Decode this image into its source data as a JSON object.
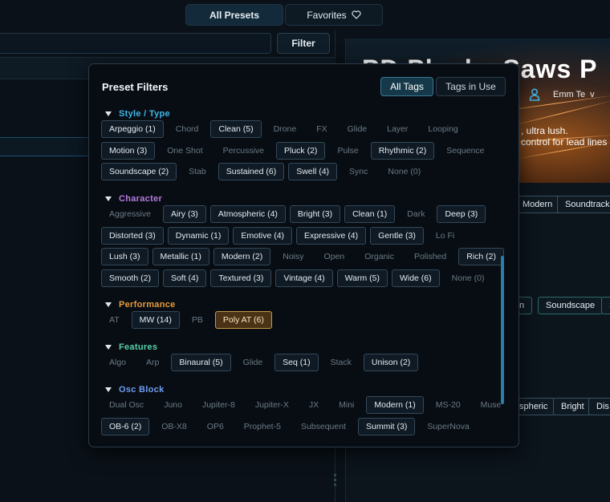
{
  "top_tabs": {
    "all_presets": "All Presets",
    "favorites": "Favorites"
  },
  "left": {
    "filter_button": "Filter"
  },
  "right": {
    "hero_title": "PD Plucks Saws P",
    "author": "Emm Te",
    "author_chevron": "v",
    "desc_line1": ", ultra lush.",
    "desc_line2": "control for lead lines",
    "tag_row1": [
      "Modern",
      "Soundtrack"
    ],
    "tag_row2": [
      "n",
      "Soundscape",
      "S"
    ],
    "tag_row3": [
      "spheric",
      "Bright",
      "Dis"
    ]
  },
  "popup": {
    "title": "Preset Filters",
    "seg_all": "All Tags",
    "seg_inuse": "Tags in Use",
    "sections": [
      {
        "name": "Style / Type",
        "color": "#3fb6e8",
        "rows": [
          [
            [
              "Arpeggio (1)",
              1
            ],
            [
              "Chord",
              0
            ],
            [
              "Clean (5)",
              1
            ],
            [
              "Drone",
              0
            ],
            [
              "FX",
              0
            ],
            [
              "Glide",
              0
            ],
            [
              "Layer",
              0
            ],
            [
              "Looping",
              0
            ]
          ],
          [
            [
              "Motion (3)",
              1
            ],
            [
              "One Shot",
              0
            ],
            [
              "Percussive",
              0
            ],
            [
              "Pluck (2)",
              1
            ],
            [
              "Pulse",
              0
            ],
            [
              "Rhythmic (2)",
              1
            ],
            [
              "Sequence",
              0
            ]
          ],
          [
            [
              "Soundscape (2)",
              1
            ],
            [
              "Stab",
              0
            ],
            [
              "Sustained (6)",
              1
            ],
            [
              "Swell (4)",
              1
            ],
            [
              "Sync",
              0
            ],
            [
              "None (0)",
              0
            ]
          ]
        ]
      },
      {
        "name": "Character",
        "color": "#b57ae0",
        "rows": [
          [
            [
              "Aggressive",
              0
            ],
            [
              "Airy (3)",
              1
            ],
            [
              "Atmospheric (4)",
              1
            ],
            [
              "Bright (3)",
              1
            ],
            [
              "Clean (1)",
              1
            ],
            [
              "Dark",
              0
            ],
            [
              "Deep (3)",
              1
            ]
          ],
          [
            [
              "Distorted (3)",
              1
            ],
            [
              "Dynamic (1)",
              1
            ],
            [
              "Emotive (4)",
              1
            ],
            [
              "Expressive (4)",
              1
            ],
            [
              "Gentle (3)",
              1
            ],
            [
              "Lo Fi",
              0
            ]
          ],
          [
            [
              "Lush (3)",
              1
            ],
            [
              "Metallic (1)",
              1
            ],
            [
              "Modern (2)",
              1
            ],
            [
              "Noisy",
              0
            ],
            [
              "Open",
              0
            ],
            [
              "Organic",
              0
            ],
            [
              "Polished",
              0
            ],
            [
              "Rich (2)",
              1
            ]
          ],
          [
            [
              "Smooth (2)",
              1
            ],
            [
              "Soft (4)",
              1
            ],
            [
              "Textured (3)",
              1
            ],
            [
              "Vintage (4)",
              1
            ],
            [
              "Warm (5)",
              1
            ],
            [
              "Wide (6)",
              1
            ],
            [
              "None (0)",
              0
            ]
          ]
        ]
      },
      {
        "name": "Performance",
        "color": "#e89a3c",
        "rows": [
          [
            [
              "AT",
              0
            ],
            [
              "MW (14)",
              1
            ],
            [
              "PB",
              0
            ],
            [
              "Poly AT (6)",
              2
            ]
          ]
        ]
      },
      {
        "name": "Features",
        "color": "#58d0a8",
        "rows": [
          [
            [
              "Algo",
              0
            ],
            [
              "Arp",
              0
            ],
            [
              "Binaural (5)",
              1
            ],
            [
              "Glide",
              0
            ],
            [
              "Seq (1)",
              1
            ],
            [
              "Stack",
              0
            ],
            [
              "Unison (2)",
              1
            ]
          ]
        ]
      },
      {
        "name": "Osc Block",
        "color": "#6f9cf0",
        "rows": [
          [
            [
              "Dual Osc",
              0
            ],
            [
              "Juno",
              0
            ],
            [
              "Jupiter-8",
              0
            ],
            [
              "Jupiter-X",
              0
            ],
            [
              "JX",
              0
            ],
            [
              "Mini",
              0
            ],
            [
              "Modern (1)",
              1
            ],
            [
              "MS-20",
              0
            ],
            [
              "Muse",
              0
            ]
          ],
          [
            [
              "OB-6 (2)",
              1
            ],
            [
              "OB-X8",
              0
            ],
            [
              "OP6",
              0
            ],
            [
              "Prophet-5",
              0
            ],
            [
              "Subsequent",
              0
            ],
            [
              "Summit (3)",
              1
            ],
            [
              "SuperNova",
              0
            ]
          ]
        ]
      }
    ]
  }
}
